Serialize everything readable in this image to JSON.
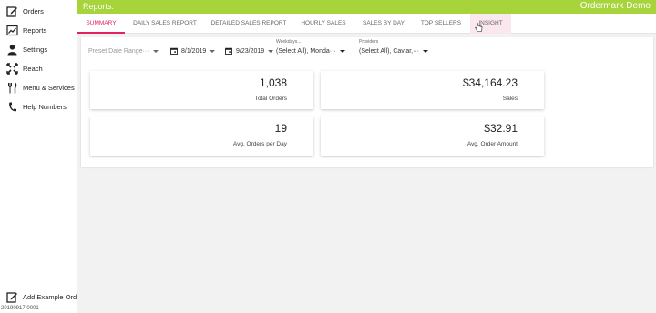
{
  "sidebar": {
    "items": [
      {
        "label": "Orders",
        "icon": "orders-icon"
      },
      {
        "label": "Reports",
        "icon": "reports-icon"
      },
      {
        "label": "Settings",
        "icon": "person-icon"
      },
      {
        "label": "Reach",
        "icon": "reach-icon"
      },
      {
        "label": "Menu & Services",
        "icon": "utensils-icon"
      },
      {
        "label": "Help Numbers",
        "icon": "phone-icon"
      }
    ],
    "bottom_action": {
      "label": "Add Example Order",
      "icon": "edit-icon"
    },
    "version": "20190917.0001"
  },
  "header": {
    "title": "Reports:",
    "brand": "Ordermark Demo",
    "bar_color": "#a6d43a"
  },
  "tabs": [
    {
      "label": "SUMMARY",
      "active": true
    },
    {
      "label": "DAILY SALES REPORT"
    },
    {
      "label": "DETAILED SALES REPORT"
    },
    {
      "label": "HOURLY SALES"
    },
    {
      "label": "SALES BY DAY"
    },
    {
      "label": "TOP SELLERS"
    },
    {
      "label": "INSIGHT",
      "hovered": true
    }
  ],
  "accent_color": "#e0245e",
  "filters": {
    "preset_placeholder": "Preset Date Range···",
    "start_date": "8/1/2019",
    "end_date": "9/23/2019",
    "weekdays_caption": "Weekdays...",
    "weekdays_value": "(Select All), Monda···",
    "providers_caption": "Providers",
    "providers_value": "(Select All), Caviar,···"
  },
  "stats": {
    "total_orders": {
      "value": "1,038",
      "label": "Total Orders"
    },
    "sales": {
      "value": "$34,164.23",
      "label": "Sales"
    },
    "avg_orders_per_day": {
      "value": "19",
      "label": "Avg. Orders per Day"
    },
    "avg_order_amount": {
      "value": "$32.91",
      "label": "Avg. Order Amount"
    }
  }
}
